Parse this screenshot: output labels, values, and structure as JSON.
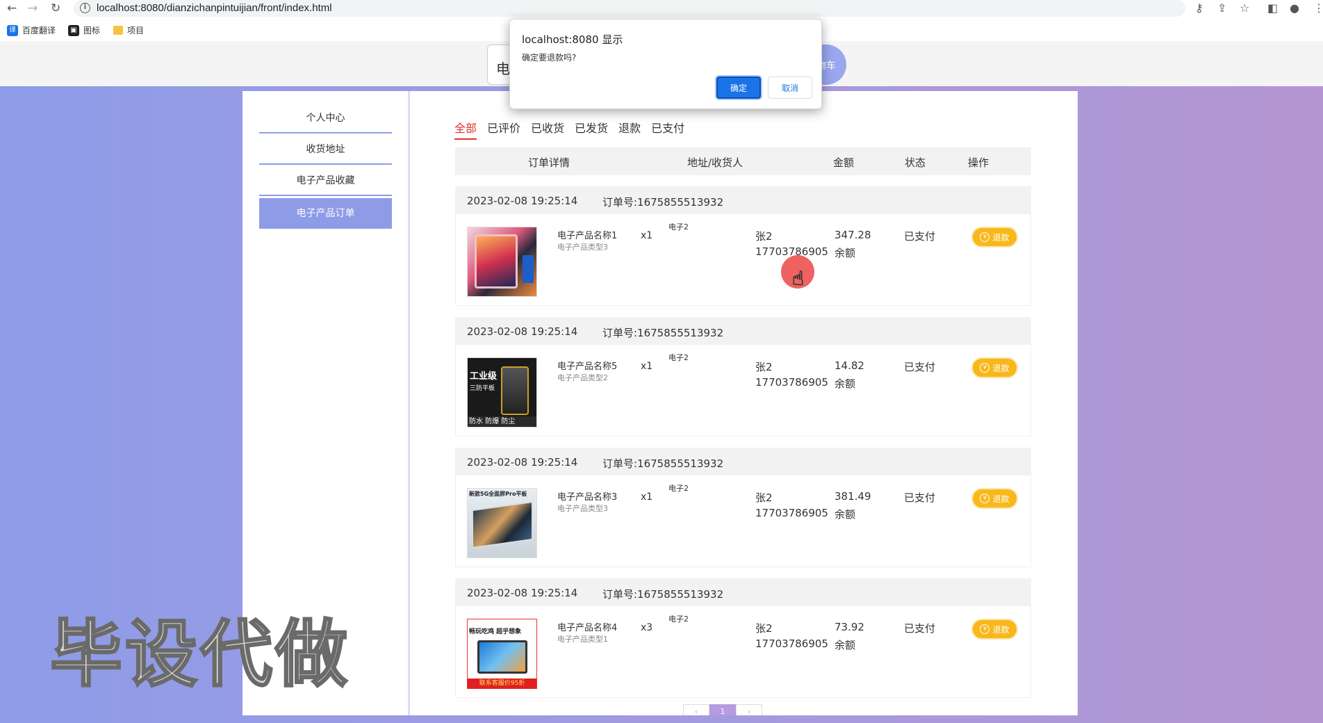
{
  "browser": {
    "url": "localhost:8080/dianzichanpintuijian/front/index.html",
    "bookmarks": [
      {
        "label": "百度翻译",
        "icon": "translate-icon",
        "color": "#1a73e8"
      },
      {
        "label": "图标",
        "icon": "image-icon",
        "color": "#222222"
      },
      {
        "label": "项目",
        "icon": "folder-icon",
        "color": "#f6c244"
      }
    ]
  },
  "header": {
    "search_partial": "电",
    "cart_partial": "物车"
  },
  "sidebar": {
    "items": [
      {
        "label": "个人中心",
        "active": false
      },
      {
        "label": "收货地址",
        "active": false
      },
      {
        "label": "电子产品收藏",
        "active": false
      },
      {
        "label": "电子产品订单",
        "active": true
      }
    ]
  },
  "tabs": [
    {
      "label": "全部",
      "active": true
    },
    {
      "label": "已评价",
      "active": false
    },
    {
      "label": "已收货",
      "active": false
    },
    {
      "label": "已发货",
      "active": false
    },
    {
      "label": "退款",
      "active": false
    },
    {
      "label": "已支付",
      "active": false
    }
  ],
  "table_headers": [
    "订单详情",
    "地址/收货人",
    "金额",
    "状态",
    "操作"
  ],
  "orders": [
    {
      "date": "2023-02-08 19:25:14",
      "order_no": "订单号:1675855513932",
      "product": "电子产品名称1",
      "type": "电子产品类型3",
      "qty": "x1",
      "address": "电子2",
      "receiver": "张2",
      "phone": "17703786905",
      "amount": "347.28",
      "pay": "余额",
      "status": "已支付",
      "action": "退款"
    },
    {
      "date": "2023-02-08 19:25:14",
      "order_no": "订单号:1675855513932",
      "product": "电子产品名称5",
      "type": "电子产品类型2",
      "qty": "x1",
      "address": "电子2",
      "receiver": "张2",
      "phone": "17703786905",
      "amount": "14.82",
      "pay": "余额",
      "status": "已支付",
      "action": "退款"
    },
    {
      "date": "2023-02-08 19:25:14",
      "order_no": "订单号:1675855513932",
      "product": "电子产品名称3",
      "type": "电子产品类型3",
      "qty": "x1",
      "address": "电子2",
      "receiver": "张2",
      "phone": "17703786905",
      "amount": "381.49",
      "pay": "余额",
      "status": "已支付",
      "action": "退款"
    },
    {
      "date": "2023-02-08 19:25:14",
      "order_no": "订单号:1675855513932",
      "product": "电子产品名称4",
      "type": "电子产品类型1",
      "qty": "x3",
      "address": "电子2",
      "receiver": "张2",
      "phone": "17703786905",
      "amount": "73.92",
      "pay": "余额",
      "status": "已支付",
      "action": "退款"
    }
  ],
  "thumb_texts": {
    "t2_line1": "工业级",
    "t2_line2": "三防平板",
    "t2_bottom": "防水 防爆 防尘",
    "t3_top": "新款5G全面屏Pro平板",
    "t4_top": "畅玩吃鸡 超乎想象",
    "t4_bottom": "联系客服价95折"
  },
  "pager": {
    "current": "1"
  },
  "watermark": "毕设代做",
  "dialog": {
    "title": "localhost:8080 显示",
    "message": "确定要退款吗?",
    "ok": "确定",
    "cancel": "取消"
  },
  "colors": {
    "accent": "#8e9ce8",
    "active_tab": "#e03030",
    "refund": "#f8b81b",
    "dialog_ok": "#1a73e8"
  }
}
